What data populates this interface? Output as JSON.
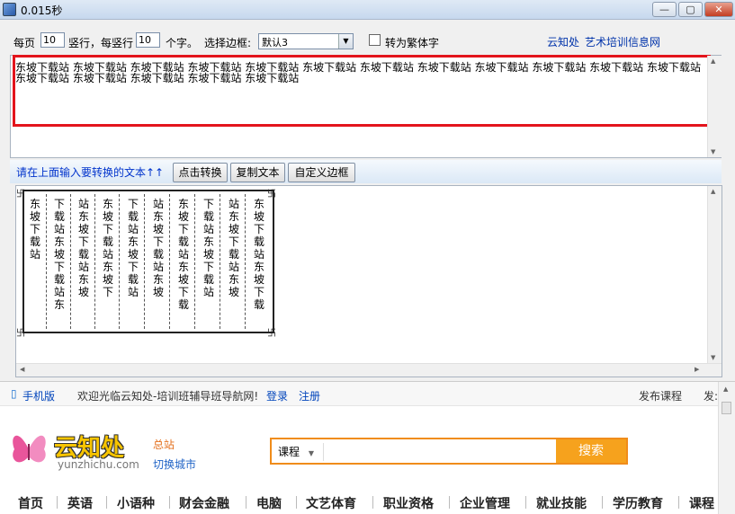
{
  "window": {
    "title": "0.015秒",
    "min_label": "—",
    "max_label": "▢",
    "close_label": "✕"
  },
  "options": {
    "per_page_label": "每页",
    "rows_value": "10",
    "per_col_label": "竖行，每竖行",
    "chars_value": "10",
    "chars_label": "个字。",
    "border_label": "选择边框:",
    "border_selected": "默认3",
    "traditional_label": "转为繁体字",
    "link1": "云知处",
    "link2": "艺术培训信息网"
  },
  "input": {
    "text": "东坡下载站 东坡下载站 东坡下载站 东坡下载站 东坡下载站 东坡下载站 东坡下载站 东坡下载站 东坡下载站 东坡下载站 东坡下载站 东坡下载站 东坡下载站 东坡下载站 东坡下载站 东坡下载站 东坡下载站"
  },
  "actions": {
    "hint": "请在上面输入要转换的文本↑↑",
    "convert": "点击转换",
    "copy": "复制文本",
    "custom_border": "自定义边框"
  },
  "output": {
    "columns": [
      "东坡下载站\n\n\n\n\n",
      "下载站\n东坡下载站\n东",
      "站\n东坡下载站\n东坡",
      "东坡下载站\n东坡下",
      "下载站\n东坡下载站\n",
      "站\n东坡下载站\n东坡",
      "东坡下载站\n东坡下载",
      "下载站\n东坡下载站",
      "站\n东坡下载站\n东坡",
      "东坡下载站\n东坡下载"
    ]
  },
  "web": {
    "mobile": "手机版",
    "welcome": "欢迎光临云知处-培训班辅导班导航网!",
    "login": "登录",
    "register": "注册",
    "post_course": "发布课程",
    "post_trunc": "发:",
    "logo_text": "云知处",
    "logo_sub": "yunzhichu.com",
    "hq": "总站",
    "switch_city": "切换城市",
    "search_type": "课程",
    "search_btn": "搜索",
    "nav": [
      "首页",
      "英语",
      "小语种",
      "财会金融",
      "电脑",
      "文艺体育",
      "职业资格",
      "企业管理",
      "就业技能",
      "学历教育",
      "课程"
    ]
  },
  "colors": {
    "accent_red": "#e3141c",
    "link_blue": "#0033aa",
    "search_orange": "#f6a21d",
    "logo_yellow": "#f7c400"
  }
}
